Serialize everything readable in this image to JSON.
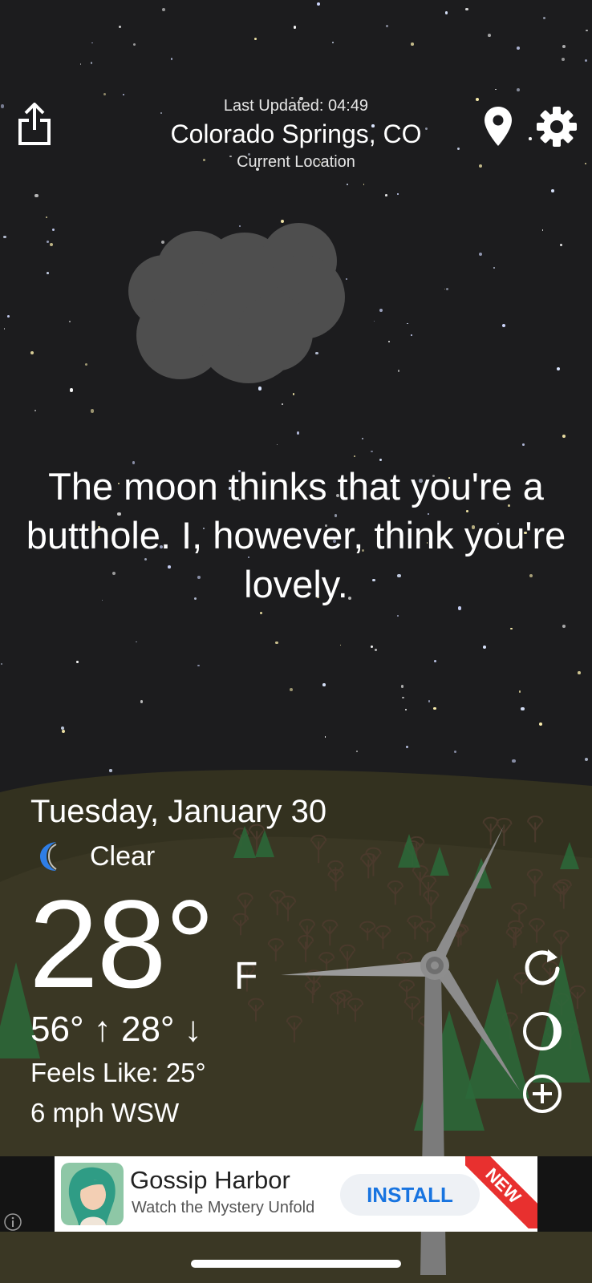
{
  "header": {
    "last_updated": "Last Updated: 04:49",
    "city": "Colorado Springs, CO",
    "location_label": "Current Location"
  },
  "quote": "The moon thinks that you're a butthole. I, however, think you're lovely.",
  "weather": {
    "date": "Tuesday, January 30",
    "condition": "Clear",
    "condition_icon": "crescent-moon-icon",
    "temperature": "28°",
    "unit": "F",
    "high_low": "56° ↑ 28° ↓",
    "feels_like": "Feels Like: 25°",
    "wind": "6 mph WSW"
  },
  "actions": {
    "share_icon": "share-icon",
    "location_icon": "map-pin-icon",
    "settings_icon": "gear-icon",
    "refresh_icon": "refresh-icon",
    "moon_phase_icon": "moon-phase-icon",
    "add_icon": "add-icon"
  },
  "ad": {
    "title": "Gossip Harbor",
    "subtitle": "Watch the Mystery Unfold",
    "install_label": "INSTALL",
    "badge": "NEW"
  },
  "colors": {
    "sky": "#1c1c1e",
    "hill": "#3a3628",
    "tree": "#2b6a3a",
    "install_text": "#1874e0",
    "badge": "#e8302f"
  }
}
